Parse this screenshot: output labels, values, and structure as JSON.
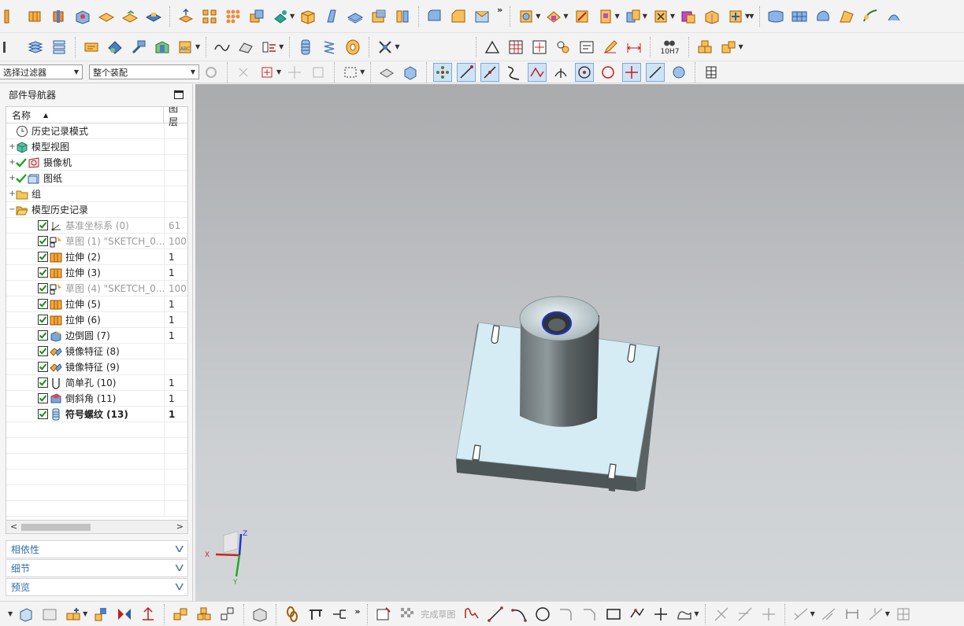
{
  "toolbar_top": {
    "more": "»",
    "more2": "»"
  },
  "toolbar_row2": {
    "tolerance_label": "10H7"
  },
  "selection_bar": {
    "filter_value": "选择过滤器",
    "scope_value": "整个装配"
  },
  "navigator": {
    "title": "部件导航器",
    "col_name": "名称",
    "col_layer": "图层",
    "rows": [
      {
        "label": "历史记录模式",
        "layer": ""
      },
      {
        "label": "模型视图",
        "layer": ""
      },
      {
        "label": "摄像机",
        "layer": ""
      },
      {
        "label": "图纸",
        "layer": ""
      },
      {
        "label": "组",
        "layer": ""
      },
      {
        "label": "模型历史记录",
        "layer": ""
      },
      {
        "label": "基准坐标系 (0)",
        "layer": "61"
      },
      {
        "label": "草图 (1) \"SKETCH_0...",
        "layer": "100"
      },
      {
        "label": "拉伸 (2)",
        "layer": "1"
      },
      {
        "label": "拉伸 (3)",
        "layer": "1"
      },
      {
        "label": "草图 (4) \"SKETCH_0...",
        "layer": "100"
      },
      {
        "label": "拉伸 (5)",
        "layer": "1"
      },
      {
        "label": "拉伸 (6)",
        "layer": "1"
      },
      {
        "label": "边倒圆 (7)",
        "layer": "1"
      },
      {
        "label": "镜像特征 (8)",
        "layer": ""
      },
      {
        "label": "镜像特征 (9)",
        "layer": ""
      },
      {
        "label": "简单孔 (10)",
        "layer": "1"
      },
      {
        "label": "倒斜角 (11)",
        "layer": "1"
      },
      {
        "label": "符号螺纹 (13)",
        "layer": "1"
      }
    ],
    "sections": [
      "相依性",
      "细节",
      "预览"
    ]
  },
  "triad": {
    "x": "X",
    "y": "Y",
    "z": "Z"
  },
  "bottom_toolbar": {
    "finish_sketch": "完成草图",
    "more": "»"
  },
  "colors": {
    "accent": "#2e6ea8",
    "model_top": "#d6ecf4",
    "model_side": "#4e5557",
    "background_top": "#a9abad",
    "background_bottom": "#d3d6d8"
  }
}
